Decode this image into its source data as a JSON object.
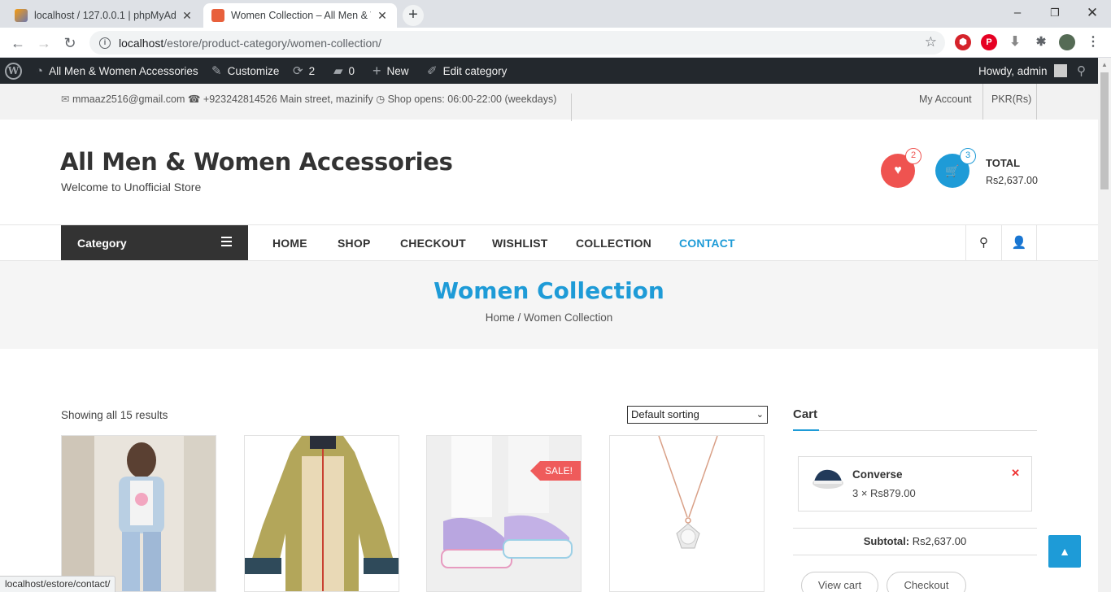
{
  "browser": {
    "tabs": [
      {
        "title": "localhost / 127.0.0.1 | phpMyAdmin"
      },
      {
        "title": "Women Collection – All Men & Women Accessories"
      }
    ],
    "url_host": "localhost",
    "url_path": "/estore/product-category/women-collection/",
    "status_url": "localhost/estore/contact/"
  },
  "adminbar": {
    "site_name": "All Men & Women Accessories",
    "customize": "Customize",
    "updates": "2",
    "comments": "0",
    "new": "New",
    "edit": "Edit category",
    "howdy": "Howdy, admin"
  },
  "topbar": {
    "info": "mmaaz2516@gmail.com ☎ +923242814526 Main street, mazinify ◷ Shop opens: 06:00-22:00 (weekdays)",
    "my_account": "My Account",
    "currency": "PKR(Rs)"
  },
  "header": {
    "title": "All Men & Women Accessories",
    "tagline": "Welcome to Unofficial Store",
    "wishlist_count": "2",
    "cart_count": "3",
    "total_label": "TOTAL",
    "total_value": "Rs2,637.00"
  },
  "nav": {
    "category": "Category",
    "links": [
      "HOME",
      "SHOP",
      "CHECKOUT",
      "WISHLIST",
      "COLLECTION",
      "CONTACT"
    ]
  },
  "banner": {
    "heading": "Women Collection",
    "breadcrumb": "Home / Women Collection"
  },
  "shop": {
    "result_count": "Showing all 15 results",
    "sort_selected": "Default sorting",
    "sale_label": "SALE!"
  },
  "cart": {
    "title": "Cart",
    "item_name": "Converse",
    "item_qty": "3 × Rs879.00",
    "subtotal_label": "Subtotal:",
    "subtotal_value": "Rs2,637.00",
    "view_cart": "View cart",
    "checkout": "Checkout"
  },
  "colors": {
    "accent": "#1e9bd7",
    "wishlist": "#ef5350",
    "sale": "#ef5b5b",
    "adminbar": "#23282d"
  }
}
